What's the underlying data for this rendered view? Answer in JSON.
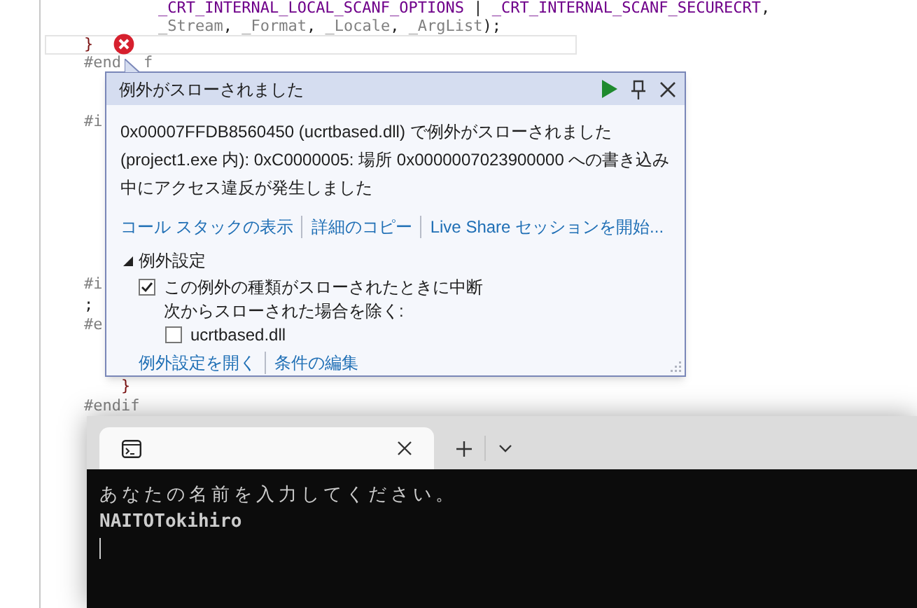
{
  "editor": {
    "code_lines": [
      {
        "kind": "code",
        "segments": [
          {
            "text": "        _CRT_INTERNAL_LOCAL_SCANF_OPTIONS",
            "kind": "macro"
          },
          {
            "text": " | ",
            "kind": "plain"
          },
          {
            "text": "_CRT_INTERNAL_SCANF_SECURECRT",
            "kind": "macro"
          },
          {
            "text": ",",
            "kind": "plain"
          }
        ]
      },
      {
        "kind": "code",
        "segments": [
          {
            "text": "        _Stream",
            "kind": "param"
          },
          {
            "text": ", ",
            "kind": "plain"
          },
          {
            "text": "_Format",
            "kind": "param"
          },
          {
            "text": ", ",
            "kind": "plain"
          },
          {
            "text": "_Locale",
            "kind": "param"
          },
          {
            "text": ", ",
            "kind": "plain"
          },
          {
            "text": "_ArgList",
            "kind": "param"
          },
          {
            "text": ");",
            "kind": "plain"
          }
        ]
      },
      {
        "kind": "code",
        "current": true,
        "error": true,
        "segments": [
          {
            "text": "}",
            "kind": "brace"
          }
        ]
      },
      {
        "kind": "code",
        "segments": [
          {
            "text": "#end",
            "kind": "directive"
          },
          {
            "text": "f",
            "kind": "directive",
            "gap_before": true
          }
        ]
      },
      {
        "kind": "blank"
      },
      {
        "kind": "blank"
      },
      {
        "kind": "code",
        "segments": [
          {
            "text": "#i",
            "kind": "directive"
          }
        ]
      },
      {
        "kind": "blank"
      },
      {
        "kind": "blank"
      },
      {
        "kind": "blank"
      },
      {
        "kind": "blank"
      },
      {
        "kind": "blank"
      },
      {
        "kind": "blank"
      },
      {
        "kind": "blank"
      },
      {
        "kind": "code",
        "segments": [
          {
            "text": "#i",
            "kind": "directive"
          }
        ]
      },
      {
        "kind": "code",
        "segments": [
          {
            "text": ";",
            "kind": "plain"
          }
        ]
      },
      {
        "kind": "code",
        "segments": [
          {
            "text": "#e",
            "kind": "directive"
          }
        ]
      },
      {
        "kind": "blank"
      },
      {
        "kind": "blank"
      },
      {
        "kind": "code",
        "segments": [
          {
            "text": "    }",
            "kind": "brace"
          }
        ]
      },
      {
        "kind": "code",
        "segments": [
          {
            "text": "#endif",
            "kind": "directive"
          }
        ]
      }
    ]
  },
  "exception_popup": {
    "title": "例外がスローされました",
    "message": "0x00007FFDB8560450 (ucrtbased.dll) で例外がスローされました (project1.exe 内): 0xC0000005: 場所 0x0000007023900000 への書き込み中にアクセス違反が発生しました",
    "links": [
      "コール スタックの表示",
      "詳細のコピー",
      "Live Share セッションを開始..."
    ],
    "settings": {
      "header": "例外設定",
      "expanded": true,
      "options": [
        {
          "kind": "checkbox",
          "label": "この例外の種類がスローされたときに中断",
          "checked": true
        },
        {
          "kind": "text",
          "label": "次からスローされた場合を除く:"
        },
        {
          "kind": "checkbox",
          "label": "ucrtbased.dll",
          "checked": false,
          "nested": true
        }
      ],
      "links": [
        "例外設定を開く",
        "条件の編集"
      ]
    }
  },
  "terminal": {
    "output_lines": [
      {
        "text": "あなたの名前を入力してください。",
        "kind": "prompt"
      },
      {
        "text": "NAITOTokihiro",
        "kind": "input"
      }
    ]
  }
}
